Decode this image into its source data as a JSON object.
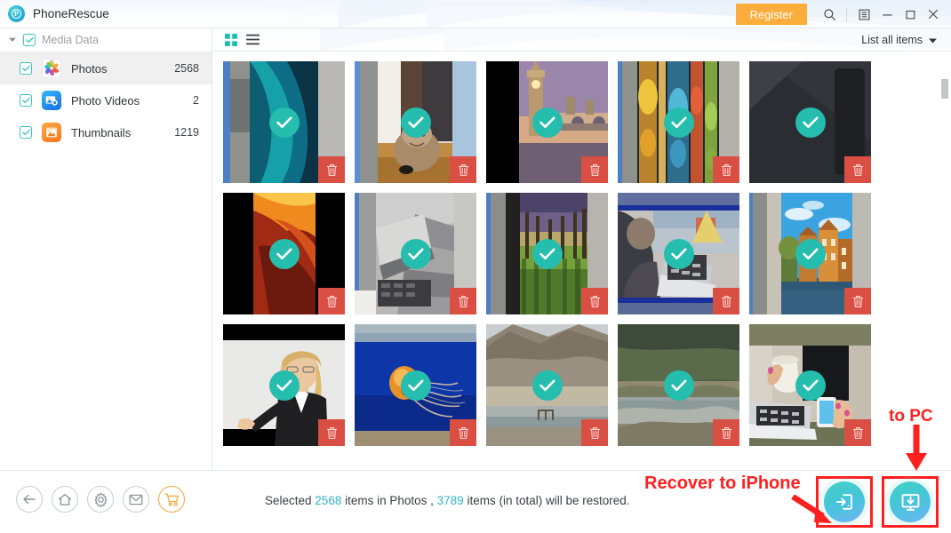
{
  "window": {
    "app_title": "PhoneRescue",
    "logo_icon": "phonerescue-logo-icon",
    "register_label": "Register",
    "search_icon": "search-icon",
    "menu_icon": "menu-icon",
    "minimize_icon": "minimize-icon",
    "maximize_icon": "maximize-icon",
    "close_icon": "close-icon"
  },
  "sidebar": {
    "group_label": "Media Data",
    "group_caret_icon": "caret-down-icon",
    "group_checkbox_icon": "checkbox-checked-icon",
    "items": [
      {
        "label": "Photos",
        "count": "2568",
        "icon": "photos-app-icon",
        "checked": true,
        "active": true
      },
      {
        "label": "Photo Videos",
        "count": "2",
        "icon": "photo-videos-icon",
        "checked": true,
        "active": false
      },
      {
        "label": "Thumbnails",
        "count": "1219",
        "icon": "thumbnails-icon",
        "checked": true,
        "active": false
      }
    ]
  },
  "toolbar": {
    "grid_view_icon": "grid-view-icon",
    "list_view_icon": "list-view-icon",
    "list_all_label": "List all items",
    "list_all_caret_icon": "chevron-down-icon"
  },
  "grid": {
    "check_icon": "check-circle-icon",
    "delete_icon": "trash-icon",
    "thumbnails": [
      {
        "id": "thumb-1",
        "description": "teal blue abstract wallpaper",
        "checked": true
      },
      {
        "id": "thumb-2",
        "description": "tabby cat on wooden floor",
        "checked": true
      },
      {
        "id": "thumb-3",
        "description": "big ben london at dusk",
        "checked": true
      },
      {
        "id": "thumb-4",
        "description": "colorful ornate lanterns",
        "checked": true
      },
      {
        "id": "thumb-5",
        "description": "dark grey phone back",
        "checked": true
      },
      {
        "id": "thumb-6",
        "description": "orange red canyon rock",
        "checked": true
      },
      {
        "id": "thumb-7",
        "description": "grey laptop on stairs",
        "checked": true
      },
      {
        "id": "thumb-8",
        "description": "tree lined avenue green field",
        "checked": true
      },
      {
        "id": "thumb-9",
        "description": "person using laptop by window",
        "checked": true
      },
      {
        "id": "thumb-10",
        "description": "amsterdam canal houses blue sky",
        "checked": true
      },
      {
        "id": "thumb-11",
        "description": "blonde businesswoman presenting",
        "checked": true
      },
      {
        "id": "thumb-12",
        "description": "orange jellyfish on blue",
        "checked": true
      },
      {
        "id": "thumb-13",
        "description": "mountain lake landscape",
        "checked": true
      },
      {
        "id": "thumb-14",
        "description": "forest lake reflection",
        "checked": true
      },
      {
        "id": "thumb-15",
        "description": "hands with coffee laptop phone",
        "checked": true
      }
    ]
  },
  "bottom": {
    "icons": [
      {
        "name": "back-icon",
        "label": "Back"
      },
      {
        "name": "home-icon",
        "label": "Home"
      },
      {
        "name": "gear-icon",
        "label": "Settings"
      },
      {
        "name": "mail-icon",
        "label": "Support"
      },
      {
        "name": "cart-icon",
        "label": "Store"
      }
    ],
    "status": {
      "prefix": "Selected ",
      "selected_count": "2568",
      "middle": " items in Photos , ",
      "total_count": "3789",
      "suffix": " items (in total) will be restored."
    },
    "recover_device_icon": "recover-to-device-icon",
    "recover_pc_icon": "recover-to-pc-icon"
  },
  "annotations": {
    "to_pc": "to PC",
    "recover_to_iphone": "Recover to iPhone",
    "color": "#ff1f1f"
  }
}
